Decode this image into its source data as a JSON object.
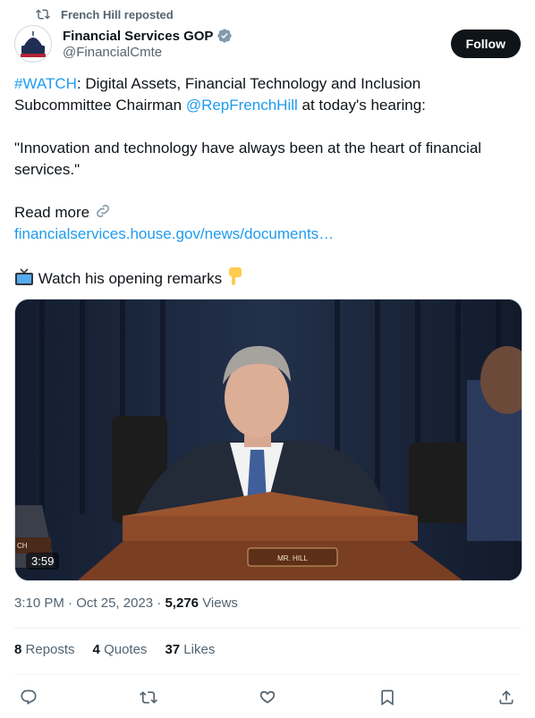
{
  "social_context": {
    "text": "French Hill reposted"
  },
  "author": {
    "display_name": "Financial Services GOP",
    "handle": "@FinancialCmte",
    "avatar_text": "FINANCIAL SERVICES"
  },
  "follow_label": "Follow",
  "tweet": {
    "hashtag": "#WATCH",
    "line1_rest": ": Digital Assets, Financial Technology and Inclusion",
    "line2_pre": "Subcommittee Chairman ",
    "mention": "@RepFrenchHill",
    "line2_post": " at today's hearing:",
    "quote": "\"Innovation and technology have always been at the heart of financial services.\"",
    "read_more": "Read more",
    "link_text": "financialservices.house.gov/news/documents…",
    "watch_text": "Watch his opening remarks"
  },
  "media": {
    "duration": "3:59",
    "nameplate": "MR. HILL",
    "left_plate_fragment": "CH"
  },
  "meta": {
    "time": "3:10 PM",
    "date": "Oct 25, 2023",
    "views_count": "5,276",
    "views_label": "Views"
  },
  "stats": {
    "reposts_count": "8",
    "reposts_label": "Reposts",
    "quotes_count": "4",
    "quotes_label": "Quotes",
    "likes_count": "37",
    "likes_label": "Likes"
  },
  "icons": {
    "repost": "repost-icon",
    "verified": "verified-badge-icon",
    "link": "link-icon",
    "tv": "television-emoji-icon",
    "point": "pointing-down-emoji-icon",
    "reply": "reply-icon",
    "retweet": "retweet-icon",
    "like": "heart-icon",
    "bookmark": "bookmark-icon",
    "share": "share-icon"
  },
  "colors": {
    "link": "#1d9bf0",
    "text": "#0f1419",
    "muted": "#536471",
    "follow_bg": "#0f1419",
    "verified": "#829aab"
  }
}
